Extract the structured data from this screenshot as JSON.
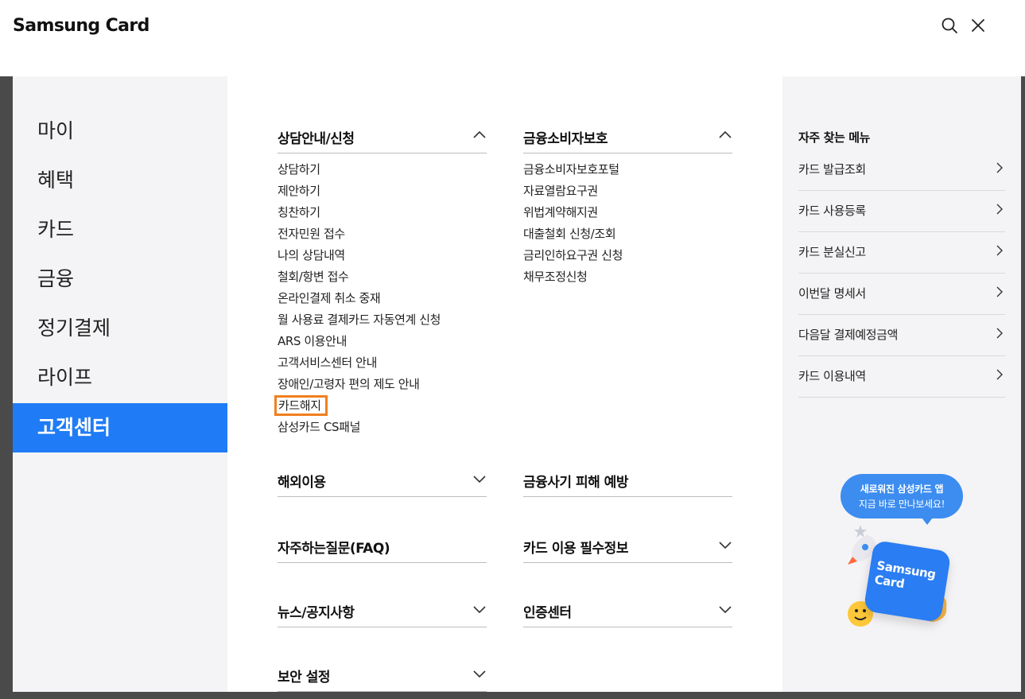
{
  "header": {
    "logo": "Samsung Card",
    "icons": [
      "search-icon",
      "close-icon"
    ]
  },
  "left_nav": {
    "items": [
      {
        "label": "마이",
        "active": false
      },
      {
        "label": "혜택",
        "active": false
      },
      {
        "label": "카드",
        "active": false
      },
      {
        "label": "금융",
        "active": false
      },
      {
        "label": "정기결제",
        "active": false
      },
      {
        "label": "라이프",
        "active": false
      },
      {
        "label": "고객센터",
        "active": true
      }
    ]
  },
  "sections": {
    "counsel": {
      "title": "상담안내/신청",
      "expanded": true,
      "items": [
        "상담하기",
        "제안하기",
        "칭찬하기",
        "전자민원 접수",
        "나의 상담내역",
        "철회/항변 접수",
        "온라인결제 취소 중재",
        "월 사용료 결제카드 자동연계 신청",
        "ARS 이용안내",
        "고객서비스센터 안내",
        "장애인/고령자 편의 제도 안내",
        "카드해지",
        "삼성카드 CS패널"
      ]
    },
    "consumer": {
      "title": "금융소비자보호",
      "expanded": true,
      "items": [
        "금융소비자보호포털",
        "자료열람요구권",
        "위법계약해지권",
        "대출철회 신청/조회",
        "금리인하요구권 신청",
        "채무조정신청"
      ]
    },
    "overseas": {
      "title": "해외이용",
      "expanded": false
    },
    "fraud": {
      "title": "금융사기 피해 예방",
      "expanded": false
    },
    "faq": {
      "title": "자주하는질문(FAQ)",
      "expanded": false
    },
    "essential": {
      "title": "카드 이용 필수정보",
      "expanded": false
    },
    "news": {
      "title": "뉴스/공지사항",
      "expanded": false
    },
    "auth": {
      "title": "인증센터",
      "expanded": false
    },
    "security": {
      "title": "보안 설정",
      "expanded": false
    }
  },
  "quick_menu": {
    "title": "자주 찾는 메뉴",
    "items": [
      "카드 발급조회",
      "카드 사용등록",
      "카드 분실신고",
      "이번달 명세서",
      "다음달 결제예정금액",
      "카드 이용내역"
    ]
  },
  "promo": {
    "line1": "새로워진 삼성카드 앱",
    "line2": "지금 바로 만나보세요!",
    "card_line1": "Samsung",
    "card_line2": "Card"
  },
  "colors": {
    "accent": "#1f7cf6",
    "highlight": "#f07f1e",
    "panel_bg": "#f4f4f6"
  }
}
